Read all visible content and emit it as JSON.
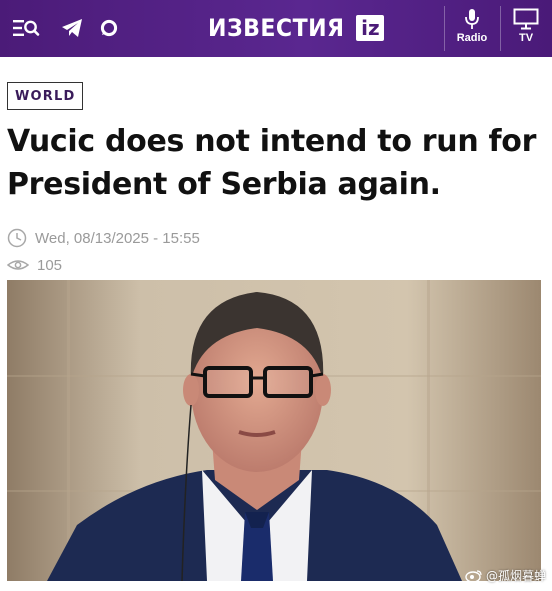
{
  "header": {
    "logo_text": "ИЗВЕСТИЯ",
    "logo_badge": "iz",
    "radio_label": "Radio",
    "tv_label": "TV",
    "icons": [
      "menu-search-icon",
      "telegram-icon",
      "chat-bubble-icon",
      "microphone-icon",
      "tv-icon"
    ],
    "colors": {
      "bar": "#4b1b78",
      "accent": "#ffffff"
    }
  },
  "article": {
    "category": "WORLD",
    "title": "Vucic does not intend to run for President of Serbia again.",
    "date": "Wed, 08/13/2025 - 15:55",
    "views": "105"
  },
  "watermark": {
    "text": "@孤烟暮蝉"
  }
}
